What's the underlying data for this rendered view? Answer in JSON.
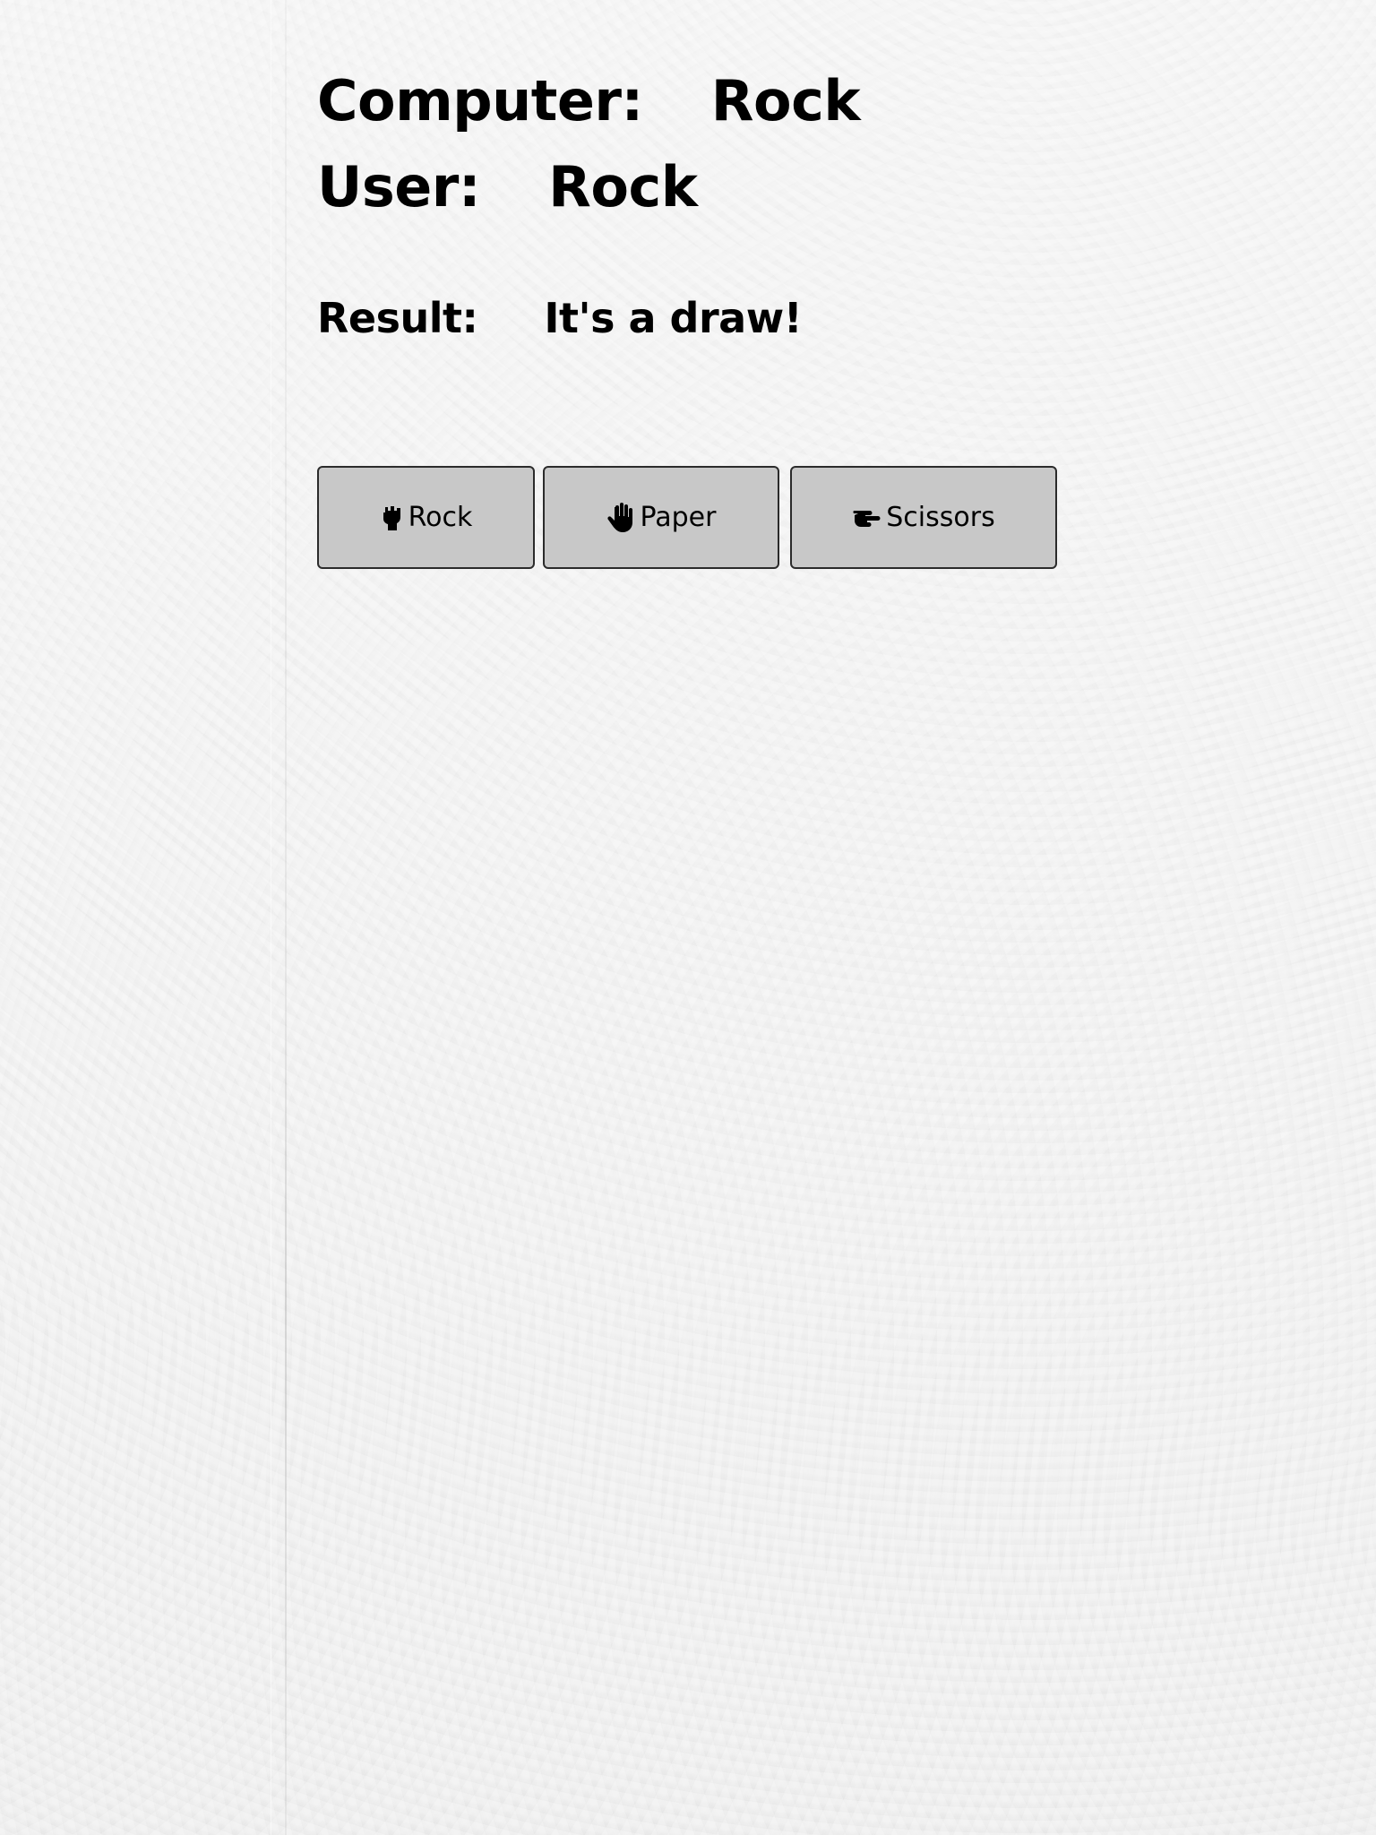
{
  "game": {
    "computer_label": "Computer:",
    "computer_choice": "Rock",
    "user_label": "User:",
    "user_choice": "Rock",
    "result_label": "Result:",
    "result_text": "It's a draw!"
  },
  "buttons": [
    {
      "label": "Rock",
      "icon": "fist-icon"
    },
    {
      "label": "Paper",
      "icon": "open-hand-icon"
    },
    {
      "label": "Scissors",
      "icon": "scissors-hand-icon"
    }
  ],
  "colors": {
    "background": "#ececec",
    "button_fill": "#c8c8c8",
    "button_border": "#2b2b2b",
    "text": "#000000"
  }
}
